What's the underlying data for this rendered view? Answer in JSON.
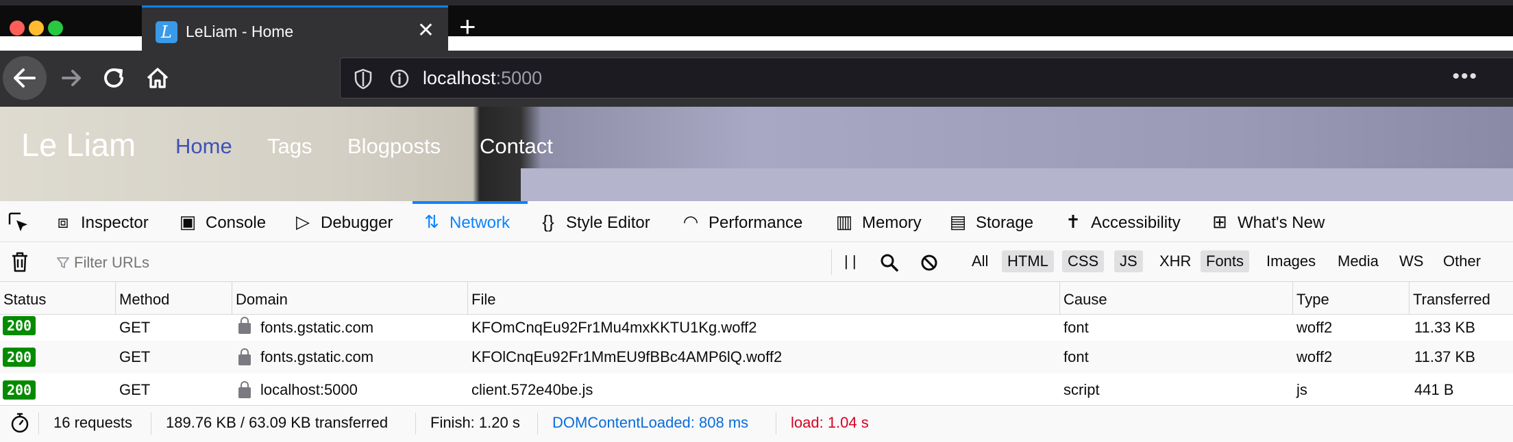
{
  "browser": {
    "tab_title": "LeLiam - Home",
    "tab_favicon": "L",
    "close_glyph": "✕",
    "new_tab_glyph": "+",
    "url_host": "localhost",
    "url_port": ":5000",
    "menu_glyph": "•••"
  },
  "site": {
    "brand": "Le Liam",
    "nav": [
      "Home",
      "Tags",
      "Blogposts",
      "Contact"
    ],
    "active_color": "#3f51b5"
  },
  "devtools": {
    "tabs": [
      "Inspector",
      "Console",
      "Debugger",
      "Network",
      "Style Editor",
      "Performance",
      "Memory",
      "Storage",
      "Accessibility",
      "What's New"
    ],
    "active_tab": "Network",
    "accent": "#0a84ff",
    "filter_placeholder": "Filter URLs",
    "type_filters": [
      "All",
      "HTML",
      "CSS",
      "JS",
      "XHR",
      "Fonts",
      "Images",
      "Media",
      "WS",
      "Other"
    ],
    "columns": [
      "Status",
      "Method",
      "Domain",
      "File",
      "Cause",
      "Type",
      "Transferred"
    ],
    "rows": [
      {
        "status": "200",
        "method": "GET",
        "domain": "fonts.gstatic.com",
        "file": "KFOmCnqEu92Fr1Mu4mxKKTU1Kg.woff2",
        "cause": "font",
        "type": "woff2",
        "transferred": "11.33 KB"
      },
      {
        "status": "200",
        "method": "GET",
        "domain": "fonts.gstatic.com",
        "file": "KFOlCnqEu92Fr1MmEU9fBBc4AMP6lQ.woff2",
        "cause": "font",
        "type": "woff2",
        "transferred": "11.37 KB"
      },
      {
        "status": "200",
        "method": "GET",
        "domain": "localhost:5000",
        "file": "client.572e40be.js",
        "cause": "script",
        "type": "js",
        "transferred": "441 B"
      }
    ],
    "summary": {
      "requests": "16 requests",
      "transferred": "189.76 KB / 63.09 KB transferred",
      "finish": "Finish: 1.20 s",
      "dom_content_loaded": "DOMContentLoaded: 808 ms",
      "load": "load: 1.04 s"
    },
    "status_color": "#058b00",
    "dcl_color": "#0a6cd8",
    "load_color": "#d70022"
  }
}
